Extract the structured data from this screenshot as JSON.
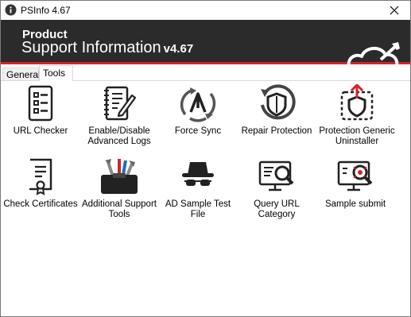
{
  "window": {
    "title": "PSInfo 4.67"
  },
  "banner": {
    "line1": "Product",
    "line2": "Support Information",
    "version": "v4.67"
  },
  "tabs": [
    {
      "label": "General",
      "active": false
    },
    {
      "label": "Tools",
      "active": true
    }
  ],
  "tools": [
    {
      "label": "URL Checker",
      "icon": "checklist-icon"
    },
    {
      "label": "Enable/Disable\nAdvanced Logs",
      "icon": "log-edit-icon"
    },
    {
      "label": "Force Sync",
      "icon": "sync-icon"
    },
    {
      "label": "Repair Protection",
      "icon": "repair-shield-icon"
    },
    {
      "label": "Protection Generic\nUninstaller",
      "icon": "uninstall-shield-icon"
    },
    {
      "label": "Check Certificates",
      "icon": "certificate-icon"
    },
    {
      "label": "Additional Support\nTools",
      "icon": "toolbox-icon"
    },
    {
      "label": "AD Sample Test File",
      "icon": "spy-icon"
    },
    {
      "label": "Query URL\nCategory",
      "icon": "monitor-search-icon"
    },
    {
      "label": "Sample submit",
      "icon": "monitor-bug-icon"
    }
  ],
  "colors": {
    "accent_red": "#d2232a",
    "banner_bg": "#2b2b2b"
  }
}
